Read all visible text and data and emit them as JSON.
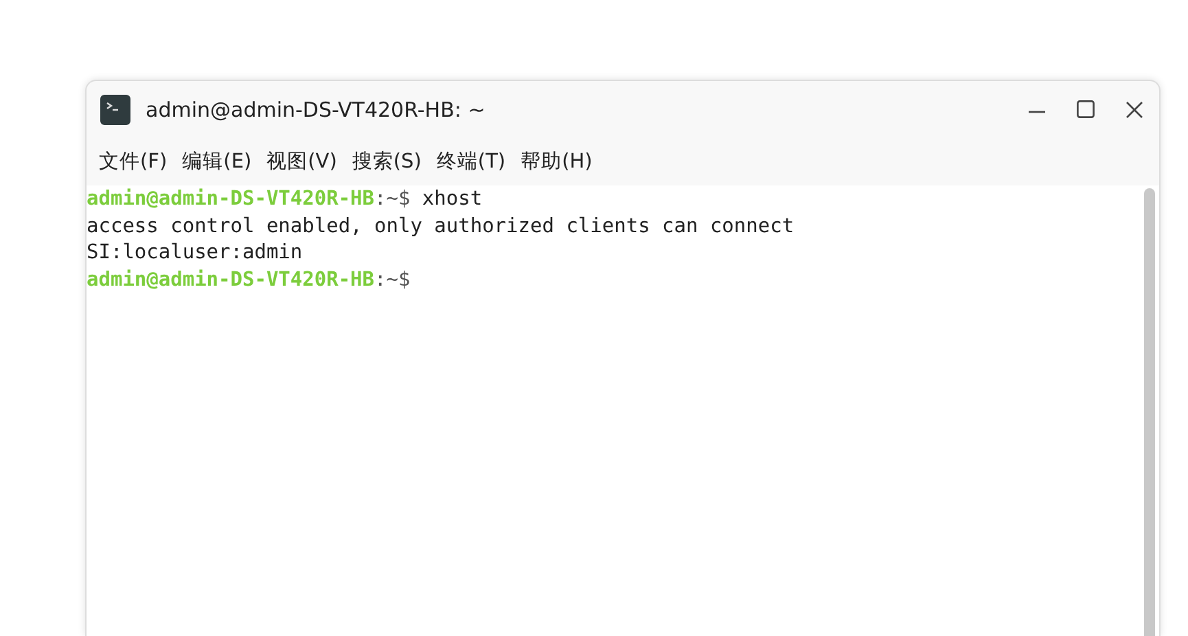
{
  "window": {
    "title": "admin@admin-DS-VT420R-HB: ~"
  },
  "menu": [
    {
      "label": "文件(F)"
    },
    {
      "label": "编辑(E)"
    },
    {
      "label": "视图(V)"
    },
    {
      "label": "搜索(S)"
    },
    {
      "label": "终端(T)"
    },
    {
      "label": "帮助(H)"
    }
  ],
  "terminal": {
    "lines": [
      {
        "kind": "prompt",
        "host": "admin@admin-DS-VT420R-HB",
        "path": ":~$",
        "command": "xhost"
      },
      {
        "kind": "output",
        "text": "access control enabled, only authorized clients can connect"
      },
      {
        "kind": "output",
        "text": "SI:localuser:admin"
      },
      {
        "kind": "prompt",
        "host": "admin@admin-DS-VT420R-HB",
        "path": ":~$"
      }
    ]
  }
}
